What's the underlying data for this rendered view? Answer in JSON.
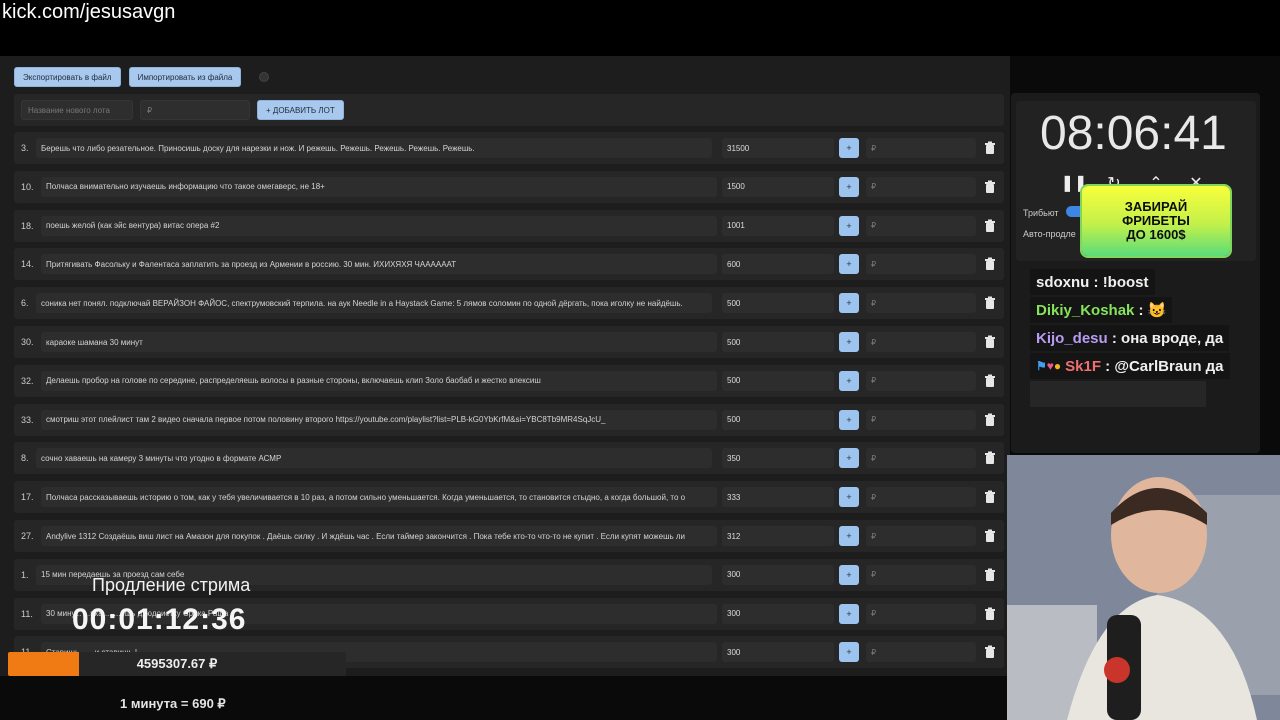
{
  "stream": {
    "url": "kick.com/jesusavgn"
  },
  "toolbar": {
    "export_label": "Экспортировать в файл",
    "import_label": "Импортировать из файла"
  },
  "new_lot": {
    "name_placeholder": "Название нового лота",
    "amount_placeholder": "₽",
    "add_label": "+ ДОБАВИТЬ ЛОТ"
  },
  "lots": [
    {
      "num": "3.",
      "title": "Берешь что либо резательное. Приносишь доску для нарезки и нож. И режешь. Режешь. Режешь. Режешь. Режешь.",
      "amount": "31500",
      "add": "₽"
    },
    {
      "num": "10.",
      "title": "Полчаса внимательно изучаешь информацию что такое омегаверс, не 18+",
      "amount": "1500",
      "add": "₽"
    },
    {
      "num": "18.",
      "title": "поешь желой (как эйс вентура) витас опера #2",
      "amount": "1001",
      "add": "₽"
    },
    {
      "num": "14.",
      "title": "Притягивать Фасольку и Фалентаса заплатить за проезд из Армении в россию. 30 мин. ИХИХЯХЯ ЧААААААТ",
      "amount": "600",
      "add": "₽"
    },
    {
      "num": "6.",
      "title": "соника нет понял. подключай ВЕРАЙЗОН ФАЙОС, спектрумовский терпила. на аук Needle in a Haystack Game: 5 лямов соломин по одной дёргать, пока иголку не найдёшь.",
      "amount": "500",
      "add": "₽"
    },
    {
      "num": "30.",
      "title": "караоке шамана 30 минут",
      "amount": "500",
      "add": "₽"
    },
    {
      "num": "32.",
      "title": "Делаешь пробор на голове по середине, распределяешь волосы в разные стороны, включаешь клип Золо баобаб и жестко влексиш",
      "amount": "500",
      "add": "₽"
    },
    {
      "num": "33.",
      "title": "смотриш этот плейлист там 2 видео сначала первое потом половину второго https://youtube.com/playlist?list=PLB-kG0YbKrfM&si=YBC8Tb9MR4SqJcU_",
      "amount": "500",
      "add": "₽"
    },
    {
      "num": "8.",
      "title": "сочно хаваешь на камеру 3 минуты что угодно в формате АСМР",
      "amount": "350",
      "add": "₽"
    },
    {
      "num": "17.",
      "title": "Полчаса рассказываешь историю о том, как у тебя увеличивается в 10 раз, а потом сильно уменьшается. Когда уменьшается, то становится стыдно, а когда большой, то о",
      "amount": "333",
      "add": "₽"
    },
    {
      "num": "27.",
      "title": "Andylive 1312 Создаёшь виш лист на Амазон для покупок . Даёшь силку . И ждёшь час . Если таймер закончится . Пока тебе кто-то что-то не купит . Если купят можешь ли",
      "amount": "312",
      "add": "₽"
    },
    {
      "num": "1.",
      "title": "15 мин передаешь за проезд сам себе",
      "amount": "300",
      "add": "₽"
    },
    {
      "num": "11.",
      "title": "30 мину... ...вка.... ...ешь дзюдоистку Срака Раша",
      "amount": "300",
      "add": "₽"
    },
    {
      "num": "11.",
      "title": "Ставишь... ...и ставишь !",
      "amount": "300",
      "add": "₽"
    }
  ],
  "timer": {
    "time": "08:06:41",
    "tribute_label": "Трибьют",
    "autoextend_label": "Авто-продле"
  },
  "promo": {
    "line1": "ЗАБИРАЙ",
    "line2": "ФРИБЕТЫ",
    "line3": "ДО 1600$"
  },
  "chat": [
    {
      "user": "sdoxnu",
      "msg": "!boost",
      "color": "#f0f0f0"
    },
    {
      "user": "Dikiy_Koshak",
      "msg": "😺",
      "color": "#86e35a"
    },
    {
      "user": "Kijo_desu",
      "msg": "она вроде, да",
      "color": "#b79cf2"
    },
    {
      "user": "Sk1F",
      "msg": "@CarlBraun да",
      "color": "#f06f6f"
    }
  ],
  "extension": {
    "title": "Продление стрима",
    "time": "00:01:12:36",
    "total": "4595307.67 ₽",
    "progress": 0.21,
    "rate": "1 минута = 690 ₽"
  },
  "colors": {
    "accent": "#9dc3ef",
    "progress": "#f07a14",
    "switch": "#3d86e6"
  }
}
